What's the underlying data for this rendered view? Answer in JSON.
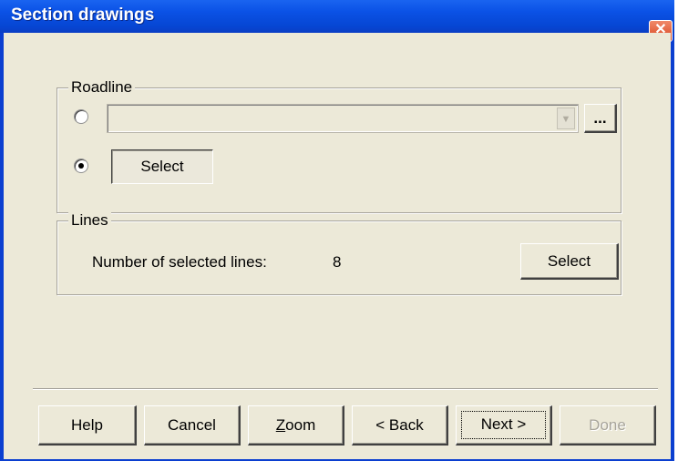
{
  "window": {
    "title": "Section drawings",
    "close_glyph": "✕"
  },
  "roadline": {
    "legend": "Roadline",
    "combo_value": "",
    "combo_arrow_glyph": "▼",
    "browse_label": "...",
    "select_label": "Select",
    "radio_combo_checked": false,
    "radio_select_checked": true
  },
  "lines": {
    "legend": "Lines",
    "count_label": "Number of selected lines:",
    "count_value": "8",
    "select_label": "Select"
  },
  "footer": {
    "help_label": "Help",
    "cancel_label": "Cancel",
    "zoom_label": "Zoom",
    "back_label": "< Back",
    "next_label": "Next >",
    "done_label": "Done"
  },
  "icons": {
    "close": "close-icon",
    "dropdown": "chevron-down-icon"
  },
  "colors": {
    "titlebar": "#0b52e6",
    "dialog_bg": "#ece9d8",
    "close_button": "#d8421c"
  }
}
